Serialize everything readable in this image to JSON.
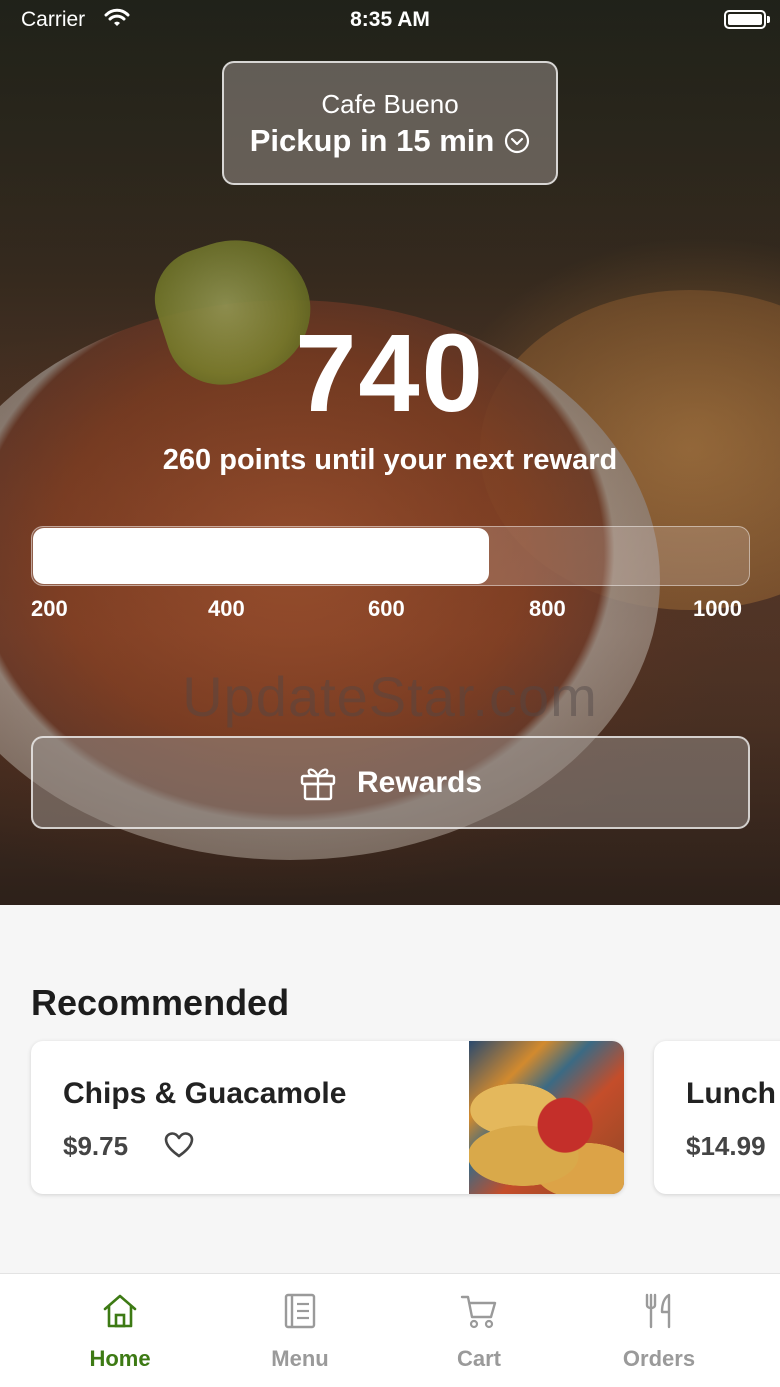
{
  "status_bar": {
    "carrier": "Carrier",
    "time": "8:35 AM"
  },
  "location": {
    "store_name": "Cafe Bueno",
    "pickup_text": "Pickup in 15 min"
  },
  "rewards": {
    "points": "740",
    "caption": "260 points until your next reward",
    "progress_fraction": 0.6375,
    "tick_labels": [
      "200",
      "400",
      "600",
      "800",
      "1000"
    ],
    "button_label": "Rewards"
  },
  "watermark": "UpdateStar.com",
  "recommended": {
    "title": "Recommended",
    "items": [
      {
        "name": "Chips & Guacamole",
        "price": "$9.75"
      },
      {
        "name": "Lunch",
        "price": "$14.99"
      }
    ]
  },
  "tab_bar": {
    "tabs": [
      {
        "label": "Home",
        "icon": "home-icon",
        "active": true
      },
      {
        "label": "Menu",
        "icon": "menu-icon",
        "active": false
      },
      {
        "label": "Cart",
        "icon": "cart-icon",
        "active": false
      },
      {
        "label": "Orders",
        "icon": "utensils-icon",
        "active": false
      }
    ],
    "active_color": "#3d7a14",
    "inactive_color": "#9a9a9a"
  }
}
